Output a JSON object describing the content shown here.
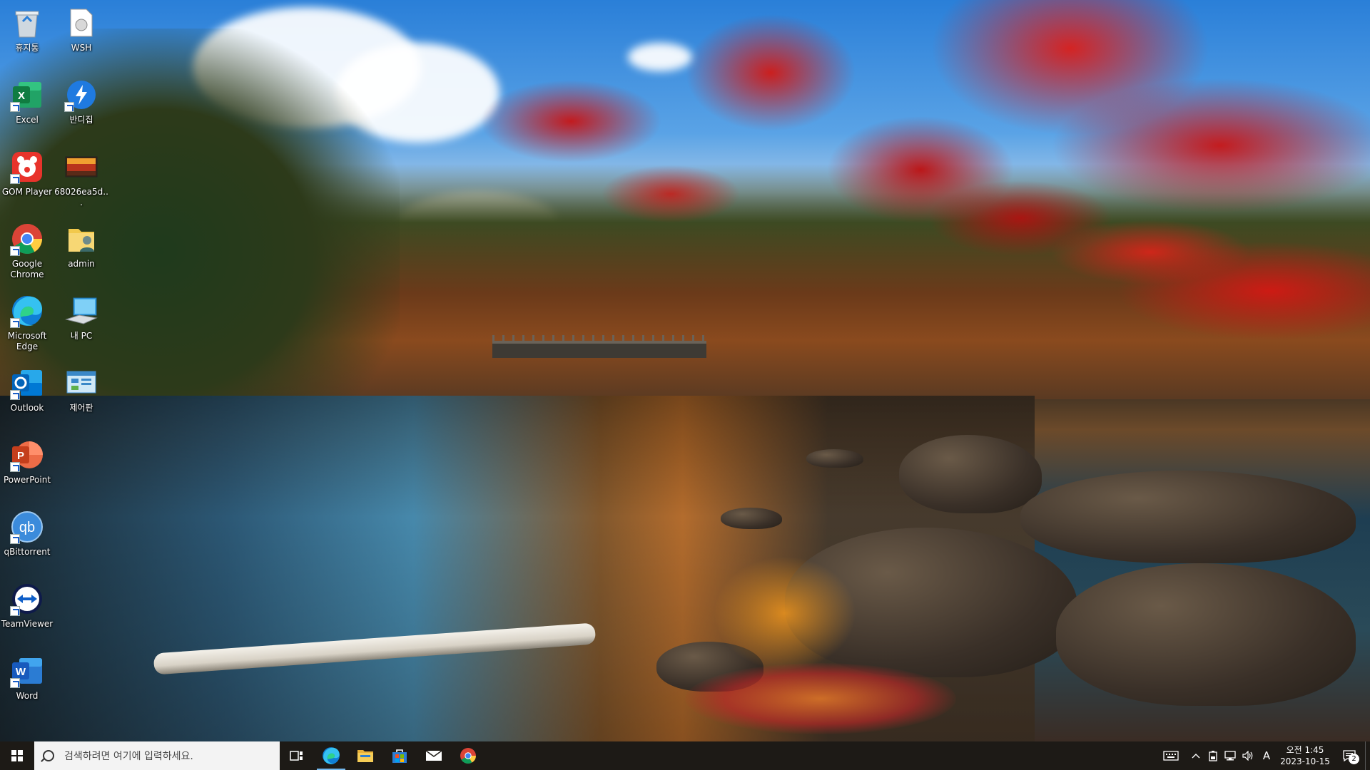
{
  "desktop": {
    "icons": [
      {
        "label": "휴지통",
        "icon": "recycle-bin-icon"
      },
      {
        "label": "WSH",
        "icon": "wsh-file-icon"
      },
      {
        "label": "Excel",
        "icon": "excel-icon"
      },
      {
        "label": "반디집",
        "icon": "bandizip-icon"
      },
      {
        "label": "GOM Player",
        "icon": "gom-player-icon"
      },
      {
        "label": "68026ea5d...",
        "icon": "image-file-icon"
      },
      {
        "label": "Google Chrome",
        "icon": "chrome-icon"
      },
      {
        "label": "admin",
        "icon": "user-folder-icon"
      },
      {
        "label": "Microsoft Edge",
        "icon": "edge-icon"
      },
      {
        "label": "내 PC",
        "icon": "this-pc-icon"
      },
      {
        "label": "Outlook",
        "icon": "outlook-icon"
      },
      {
        "label": "제어판",
        "icon": "control-panel-icon"
      },
      {
        "label": "PowerPoint",
        "icon": "powerpoint-icon"
      },
      {
        "label": "qBittorrent",
        "icon": "qbittorrent-icon"
      },
      {
        "label": "TeamViewer",
        "icon": "teamviewer-icon"
      },
      {
        "label": "Word",
        "icon": "word-icon"
      }
    ]
  },
  "taskbar": {
    "search_placeholder": "검색하려면 여기에 입력하세요.",
    "pinned": [
      "task-view-icon",
      "edge-icon",
      "file-explorer-icon",
      "microsoft-store-icon",
      "mail-icon",
      "chrome-icon"
    ],
    "tray": {
      "ime": "A",
      "time": "오전 1:45",
      "date": "2023-10-15",
      "notification_count": "2"
    }
  },
  "colors": {
    "taskbar_bg": "#1d1a16",
    "active_indicator": "#76b9ed",
    "search_bg": "#f3f3f3"
  }
}
